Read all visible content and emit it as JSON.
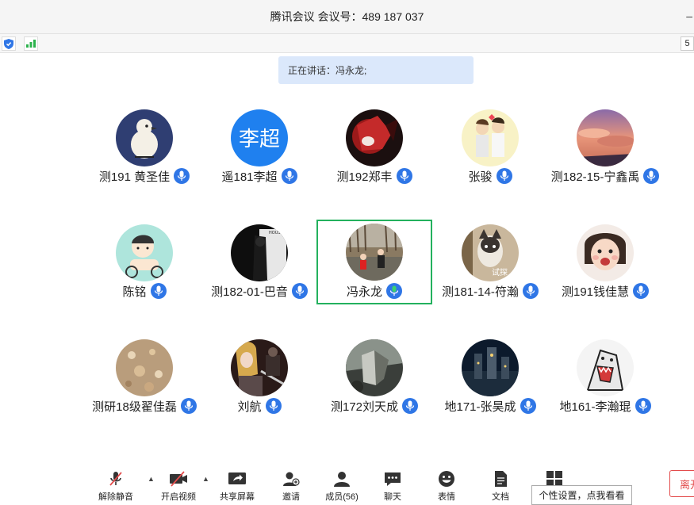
{
  "window": {
    "title": "腾讯会议  会议号：489 187 037",
    "minimize": "–"
  },
  "statusbar": {
    "right_value": "5"
  },
  "speaking": {
    "text": "正在讲话：冯永龙;"
  },
  "participants": [
    {
      "name": "测191 黄圣佳",
      "avatar": "pigeon-cartoon"
    },
    {
      "name": "遥181李超",
      "avatar": "initials",
      "initials": "李超"
    },
    {
      "name": "测192郑丰",
      "avatar": "red-anime"
    },
    {
      "name": "张骏",
      "avatar": "couple-cartoon"
    },
    {
      "name": "测182-15-宁鑫禹",
      "avatar": "sunset-sky"
    },
    {
      "name": "陈铭",
      "avatar": "cartoon-rider"
    },
    {
      "name": "测182-01-巴音",
      "avatar": "dark-photo"
    },
    {
      "name": "冯永龙",
      "avatar": "outdoor-photo",
      "active": true
    },
    {
      "name": "测181-14-符瀚",
      "avatar": "dog-photo",
      "overlay": "试探"
    },
    {
      "name": "测191钱佳慧",
      "avatar": "child-photo"
    },
    {
      "name": "测研18级翟佳磊",
      "avatar": "texture-photo"
    },
    {
      "name": "刘航",
      "avatar": "guitarist-photo"
    },
    {
      "name": "测172刘天成",
      "avatar": "game-art"
    },
    {
      "name": "地171-张昊成",
      "avatar": "castle-night"
    },
    {
      "name": "地161-李瀚琨",
      "avatar": "shark-cartoon"
    }
  ],
  "toolbar": {
    "unmute": "解除静音",
    "video": "开启视频",
    "share": "共享屏幕",
    "invite": "邀请",
    "members": "成员(56)",
    "chat": "聊天",
    "emoji": "表情",
    "docs": "文档",
    "apps": ""
  },
  "tooltip": "个性设置，点我看看",
  "leave_label": "离开",
  "colors": {
    "accent": "#2f76e6",
    "active_border": "#23b15e",
    "speaking_bg": "#dbe8fb",
    "leave": "#e34c4c"
  }
}
